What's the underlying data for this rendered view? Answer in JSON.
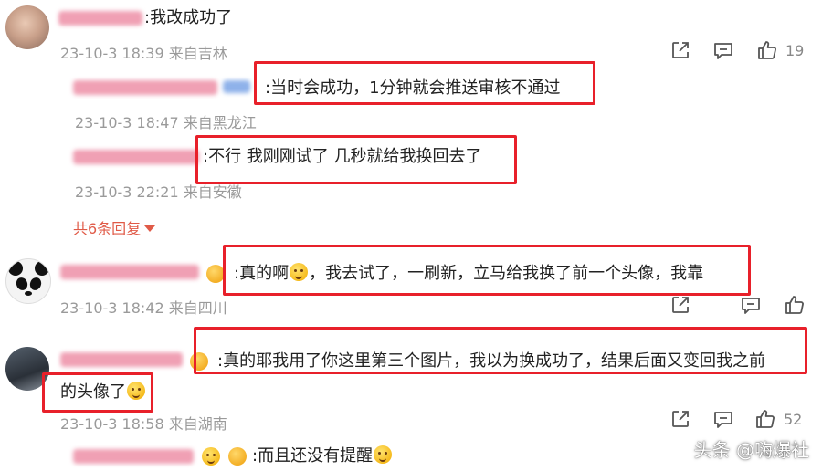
{
  "comments": [
    {
      "text": ":我改成功了",
      "meta": "23-10-3 18:39 来自吉林",
      "likes": "19",
      "replies": [
        {
          "text": ":当时会成功，1分钟就会推送审核不通过",
          "meta": "23-10-3 18:47 来自黑龙江"
        },
        {
          "text": ":不行 我刚刚试了 几秒就给我换回去了",
          "meta": "23-10-3 22:21 来自安徽"
        }
      ],
      "more_replies": "共6条回复"
    },
    {
      "text_a": ":真的啊",
      "text_b": "，我去试了，一刷新，立马给我换了前一个头像，我靠",
      "meta": "23-10-3 18:42 来自四川"
    },
    {
      "text_line1": ":真的耶我用了你这里第三个图片，我以为换成功了，结果后面又变回我之前",
      "text_line2": "的头像了",
      "meta": "23-10-3 18:58 来自湖南",
      "likes": "52"
    },
    {
      "text": ":而且还没有提醒"
    }
  ],
  "watermark": "头条 @嗨爆社",
  "colors": {
    "highlight_box": "#e8202a",
    "more_link": "#e05a47",
    "meta_text": "#9a9a9a"
  }
}
